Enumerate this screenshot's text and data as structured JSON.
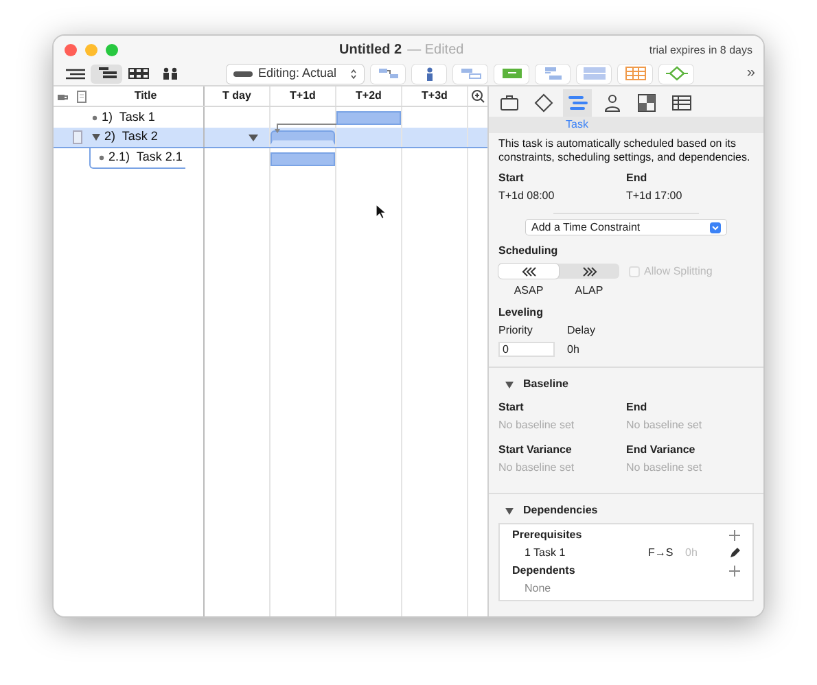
{
  "window": {
    "title": "Untitled 2",
    "edited": "— Edited",
    "trial": "trial expires in 8 days"
  },
  "toolbar": {
    "views": [
      {
        "selected": false
      },
      {
        "selected": true
      },
      {
        "selected": false
      },
      {
        "selected": false
      }
    ],
    "editing": "Editing: Actual",
    "overflow": "»"
  },
  "outline": {
    "columns": [
      "Title",
      "T day",
      "T+1d",
      "T+2d",
      "T+3d"
    ],
    "rows": [
      {
        "number": "1)",
        "title": "Task 1",
        "selected": false,
        "kind": "task",
        "note": false
      },
      {
        "number": "2)",
        "title": "Task 2",
        "selected": true,
        "kind": "group",
        "expanded": true,
        "note": true,
        "children": [
          {
            "number": "2.1)",
            "title": "Task 2.1",
            "selected": false,
            "kind": "task",
            "note": false
          }
        ]
      }
    ]
  },
  "inspector": {
    "tabs": [
      {
        "selected": false
      },
      {
        "selected": false
      },
      {
        "selected": true,
        "label": "Task"
      },
      {
        "selected": false
      },
      {
        "selected": false
      },
      {
        "selected": false
      }
    ],
    "description": "This task is automatically scheduled based on its constraints, scheduling settings, and dependencies.",
    "start": {
      "label": "Start",
      "value": "T+1d 08:00"
    },
    "end": {
      "label": "End",
      "value": "T+1d 17:00"
    },
    "constraint_popup": "Add a Time Constraint",
    "scheduling": {
      "heading": "Scheduling",
      "modes": [
        {
          "label": "ASAP",
          "selected": true
        },
        {
          "label": "ALAP",
          "selected": false
        }
      ],
      "allow_splitting": {
        "label": "Allow Splitting",
        "checked": false,
        "disabled": true
      }
    },
    "leveling": {
      "heading": "Leveling",
      "priority_label": "Priority",
      "priority": "0",
      "delay_label": "Delay",
      "delay": "0h"
    },
    "baseline": {
      "heading": "Baseline",
      "expanded": true,
      "fields": [
        {
          "label": "Start",
          "value": "No baseline set"
        },
        {
          "label": "End",
          "value": "No baseline set"
        },
        {
          "label": "Start Variance",
          "value": "No baseline set"
        },
        {
          "label": "End Variance",
          "value": "No baseline set"
        }
      ]
    },
    "dependencies": {
      "heading": "Dependencies",
      "expanded": true,
      "prerequisites": {
        "heading": "Prerequisites",
        "items": [
          {
            "task": "1 Task 1",
            "type": "F→S",
            "lag": "0h"
          }
        ]
      },
      "dependents": {
        "heading": "Dependents",
        "empty": "None"
      }
    }
  }
}
